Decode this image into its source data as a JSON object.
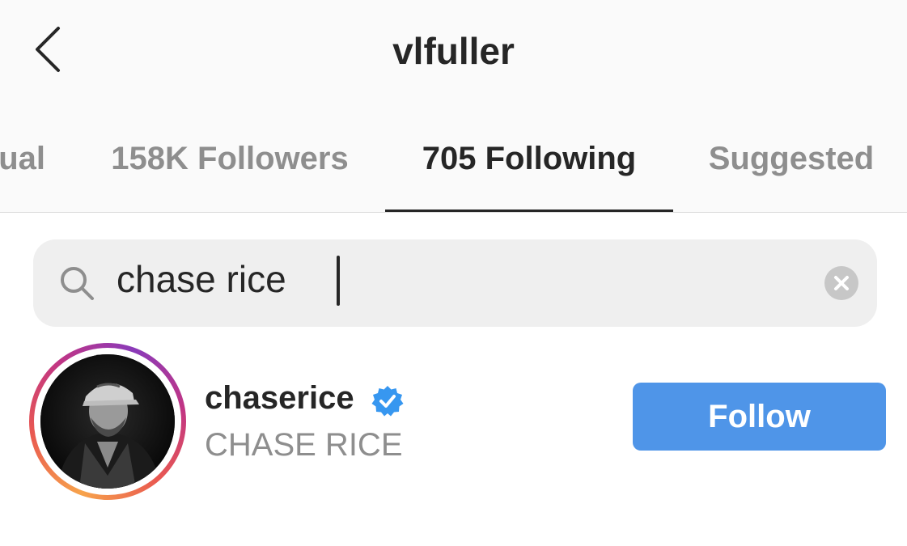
{
  "header": {
    "title": "vlfuller",
    "back_icon": "chevron-left-icon"
  },
  "tabs": [
    {
      "label": "Mutual",
      "visible_text": "ual",
      "active": false
    },
    {
      "label": "158K Followers",
      "active": false
    },
    {
      "label": "705 Following",
      "active": true
    },
    {
      "label": "Suggested",
      "active": false
    }
  ],
  "search": {
    "value": "chase rice",
    "icon": "search-icon",
    "clear_icon": "clear-icon"
  },
  "results": [
    {
      "username": "chaserice",
      "verified": true,
      "full_name": "CHASE RICE",
      "action_label": "Follow"
    }
  ],
  "colors": {
    "accent": "#4f95e8",
    "verified": "#3797f0",
    "header_bg": "#fafafa",
    "muted_text": "#8e8e8e"
  }
}
